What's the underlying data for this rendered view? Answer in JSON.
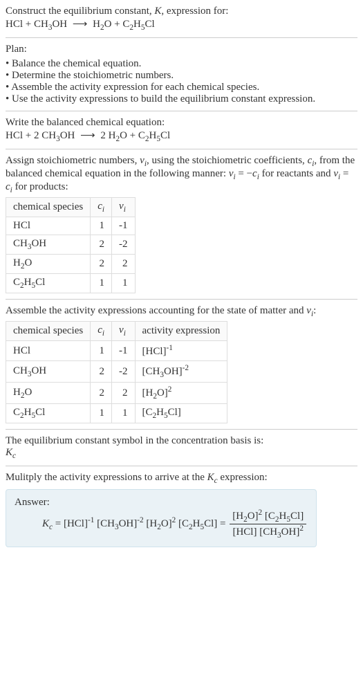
{
  "intro": {
    "line1": "Construct the equilibrium constant, K, expression for:",
    "equation_unbalanced": "HCl + CH₃OH ⟶ H₂O + C₂H₅Cl"
  },
  "plan": {
    "header": "Plan:",
    "items": [
      "Balance the chemical equation.",
      "Determine the stoichiometric numbers.",
      "Assemble the activity expression for each chemical species.",
      "Use the activity expressions to build the equilibrium constant expression."
    ]
  },
  "balanced": {
    "header": "Write the balanced chemical equation:",
    "equation": "HCl + 2 CH₃OH ⟶ 2 H₂O + C₂H₅Cl"
  },
  "stoich": {
    "intro": "Assign stoichiometric numbers, νᵢ, using the stoichiometric coefficients, cᵢ, from the balanced chemical equation in the following manner: νᵢ = −cᵢ for reactants and νᵢ = cᵢ for products:",
    "headers": {
      "species": "chemical species",
      "ci": "cᵢ",
      "vi": "νᵢ"
    },
    "rows": [
      {
        "species": "HCl",
        "ci": "1",
        "vi": "-1"
      },
      {
        "species": "CH₃OH",
        "ci": "2",
        "vi": "-2"
      },
      {
        "species": "H₂O",
        "ci": "2",
        "vi": "2"
      },
      {
        "species": "C₂H₅Cl",
        "ci": "1",
        "vi": "1"
      }
    ]
  },
  "activity": {
    "intro": "Assemble the activity expressions accounting for the state of matter and νᵢ:",
    "headers": {
      "species": "chemical species",
      "ci": "cᵢ",
      "vi": "νᵢ",
      "expr": "activity expression"
    },
    "rows": [
      {
        "species": "HCl",
        "ci": "1",
        "vi": "-1",
        "expr": "[HCl]⁻¹"
      },
      {
        "species": "CH₃OH",
        "ci": "2",
        "vi": "-2",
        "expr": "[CH₃OH]⁻²"
      },
      {
        "species": "H₂O",
        "ci": "2",
        "vi": "2",
        "expr": "[H₂O]²"
      },
      {
        "species": "C₂H₅Cl",
        "ci": "1",
        "vi": "1",
        "expr": "[C₂H₅Cl]"
      }
    ]
  },
  "symbol": {
    "line1": "The equilibrium constant symbol in the concentration basis is:",
    "line2": "K_c"
  },
  "final": {
    "intro": "Mulitply the activity expressions to arrive at the K_c expression:",
    "answer_label": "Answer:",
    "kc_flat": "K_c = [HCl]⁻¹ [CH₃OH]⁻² [H₂O]² [C₂H₅Cl] =",
    "frac_num": "[H₂O]² [C₂H₅Cl]",
    "frac_den": "[HCl] [CH₃OH]²"
  }
}
